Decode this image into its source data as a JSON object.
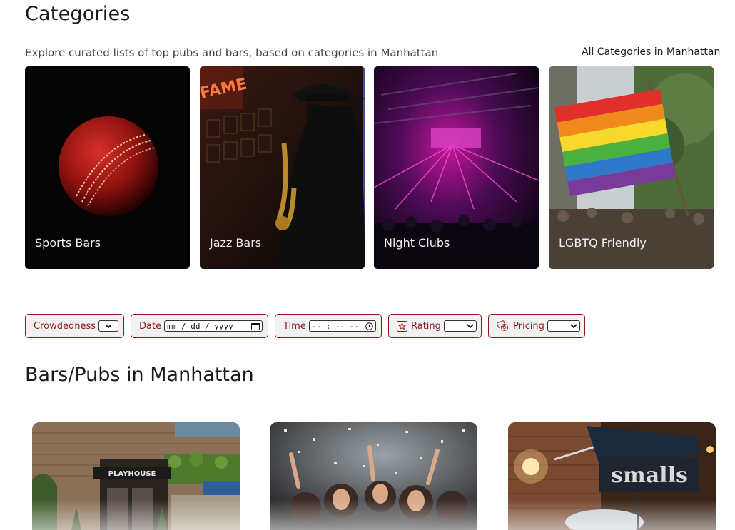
{
  "categories_section": {
    "title": "Categories",
    "subtitle": "Explore curated lists of top pubs and bars, based on categories in Manhattan",
    "all_link": "All Categories in Manhattan",
    "cards": [
      {
        "label": "Sports Bars",
        "image": "cricket-ball"
      },
      {
        "label": "Jazz Bars",
        "image": "saxophone-player"
      },
      {
        "label": "Night Clubs",
        "image": "stage-lights"
      },
      {
        "label": "LGBTQ Friendly",
        "image": "rainbow-flag"
      }
    ]
  },
  "filters": {
    "crowdedness": {
      "label": "Crowdedness"
    },
    "date": {
      "label": "Date",
      "placeholder": "mm / dd / yyyy"
    },
    "time": {
      "label": "Time",
      "placeholder": "-- : --  --"
    },
    "rating": {
      "label": "Rating",
      "icon": "star-icon"
    },
    "pricing": {
      "label": "Pricing",
      "icon": "money-icon"
    },
    "accent": "#8b1a1a"
  },
  "bars_section": {
    "title": "Bars/Pubs in Manhattan",
    "cards": [
      {
        "image": "playhouse-building",
        "sign": "PLAYHOUSE"
      },
      {
        "image": "confetti-party"
      },
      {
        "image": "smalls-sign",
        "sign": "smalls"
      }
    ]
  }
}
